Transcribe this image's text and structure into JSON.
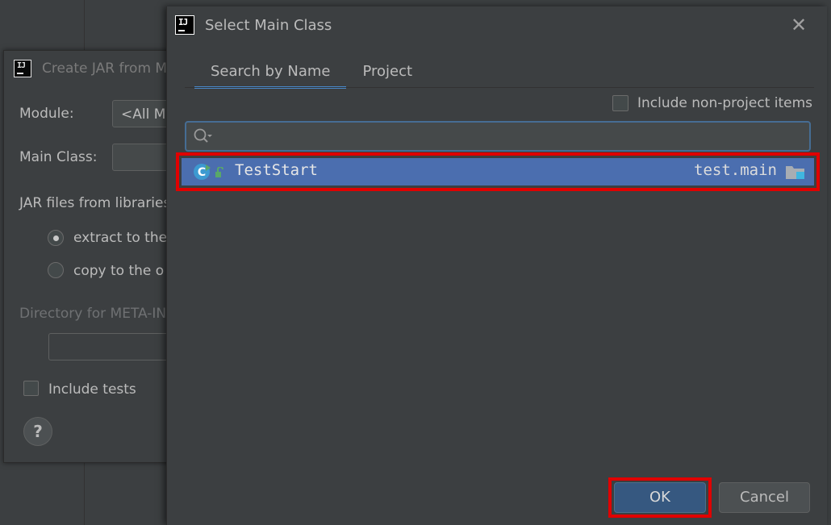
{
  "jar_dialog": {
    "title": "Create JAR from M",
    "module_label": "Module:",
    "module_value": "<All M",
    "main_class_label": "Main Class:",
    "libraries_label": "JAR files from libraries",
    "radio_extract": "extract to the",
    "radio_copy": "copy to the o",
    "meta_dir_label": "Directory for META-IN",
    "include_tests_label": "Include tests",
    "help_label": "?"
  },
  "dialog": {
    "title": "Select Main Class",
    "close_label": "✕",
    "tabs": [
      {
        "label": "Search by Name",
        "active": true
      },
      {
        "label": "Project",
        "active": false
      }
    ],
    "include_non_project_label": "Include non-project items",
    "search_value": "",
    "results": [
      {
        "name": "TestStart",
        "package": "test.main",
        "icon": "class-icon",
        "selected": true
      }
    ],
    "ok_label": "OK",
    "cancel_label": "Cancel"
  },
  "colors": {
    "background": "#3c3f41",
    "selection": "#4b6eaf",
    "tab_underline": "#4a88c7",
    "highlight": "#e00000",
    "ok_button": "#365880"
  }
}
